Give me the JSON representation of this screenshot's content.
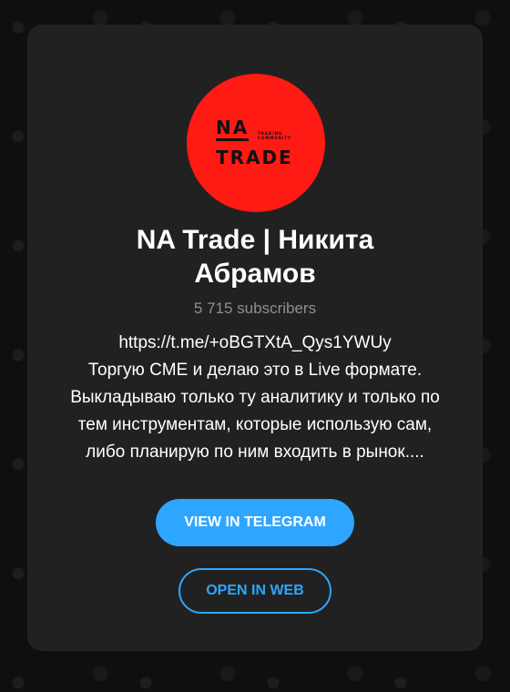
{
  "channel": {
    "logo": {
      "primary_text": "NA",
      "secondary_text": "TRADE",
      "small_text": "TRADING COMMUNITY",
      "background_color": "#ff1a14",
      "text_color": "#111111"
    },
    "title_line1": "NA Trade | Никита",
    "title_line2": "Абрамов",
    "subscribers": "5 715 subscribers",
    "description_lines": [
      "https://t.me/+oBGTXtA_Qys1YWUy",
      "Торгую CME и делаю это в Live формате.",
      "Выкладываю только ту аналитику и только по",
      "тем инструментам, которые использую сам,",
      "либо планирую по ним входить в рынок...."
    ]
  },
  "actions": {
    "view_label": "VIEW IN TELEGRAM",
    "web_label": "OPEN IN WEB"
  },
  "colors": {
    "page_background": "#0f0f0f",
    "card_background": "#212121",
    "accent": "#2ea6ff",
    "muted_text": "#8f8f8f"
  }
}
